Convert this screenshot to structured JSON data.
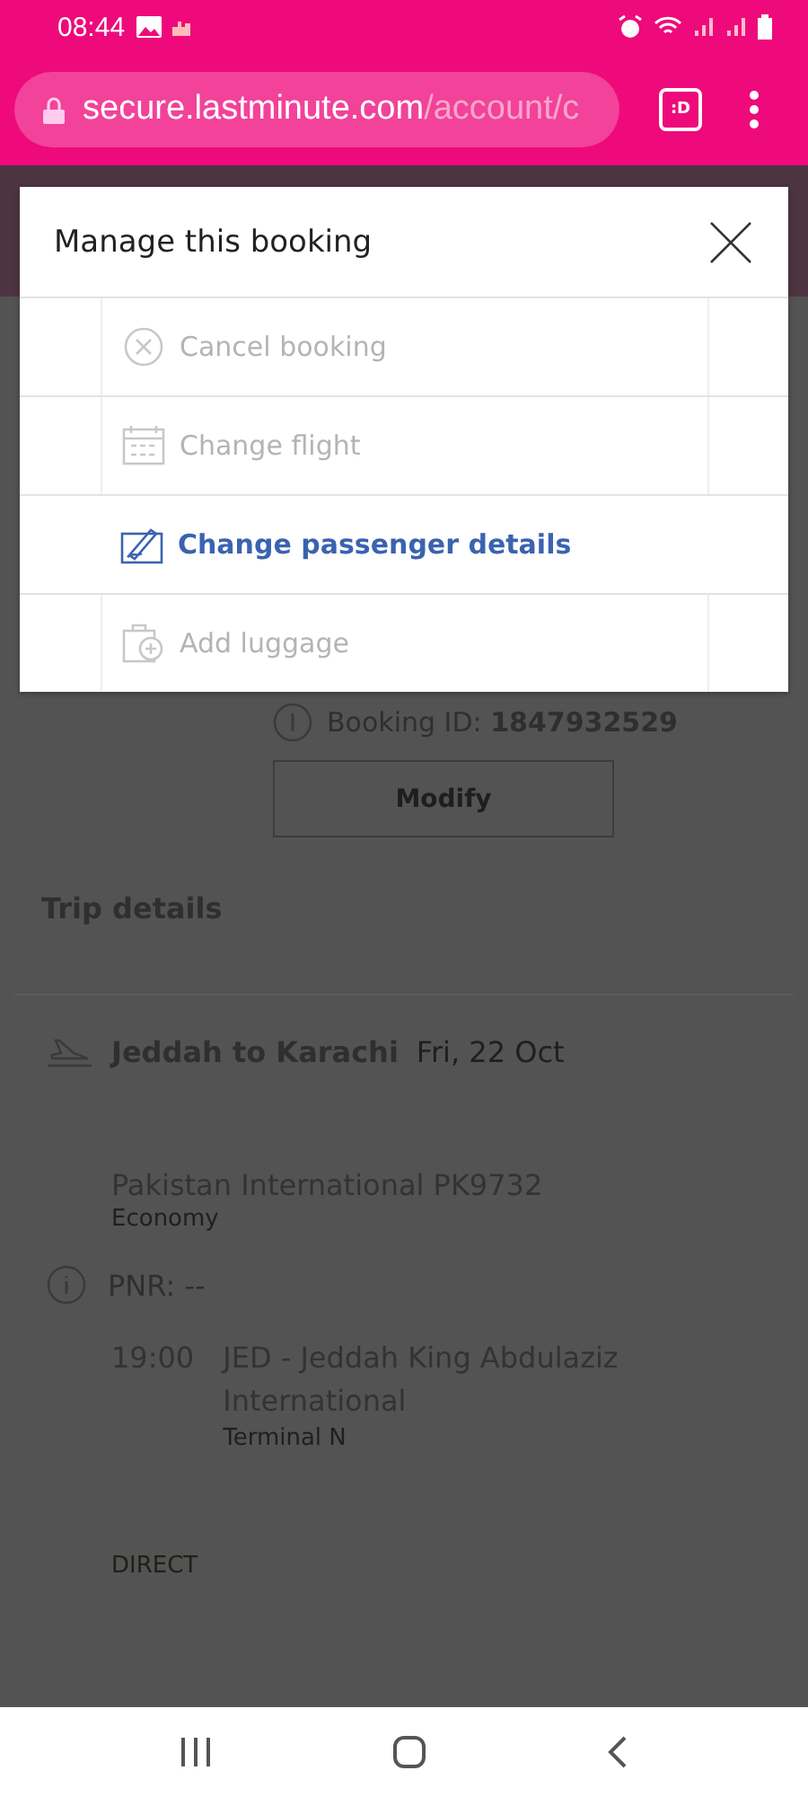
{
  "status_bar": {
    "time": "08:44"
  },
  "browser": {
    "url_host": "secure.lastminute.com",
    "url_path": "/account/c",
    "tab_count": ":D"
  },
  "page": {
    "booking_id": "Booking ID: **1847932529**",
    "modify_button": "Modify",
    "section_title": "Trip details",
    "leg": {
      "route": "Jeddah to Karachi",
      "date": "Fri, 22 Oct"
    },
    "flight": {
      "airline": "Pakistan International PK9732",
      "cabin": "Economy",
      "pnr": "PNR: --",
      "departure_time": "19:00",
      "departure_airport": "JED - Jeddah King Abdulaziz International",
      "terminal": "Terminal N",
      "stops": "DIRECT"
    }
  },
  "modal": {
    "title": "Manage this booking",
    "actions": [
      {
        "label": "Cancel booking",
        "kind": "cancel",
        "disabled": true
      },
      {
        "label": "Change flight",
        "kind": "calendar",
        "disabled": true
      },
      {
        "label": "Change passenger details",
        "kind": "edit",
        "disabled": false
      },
      {
        "label": "Add luggage",
        "kind": "luggage",
        "disabled": true
      }
    ]
  }
}
